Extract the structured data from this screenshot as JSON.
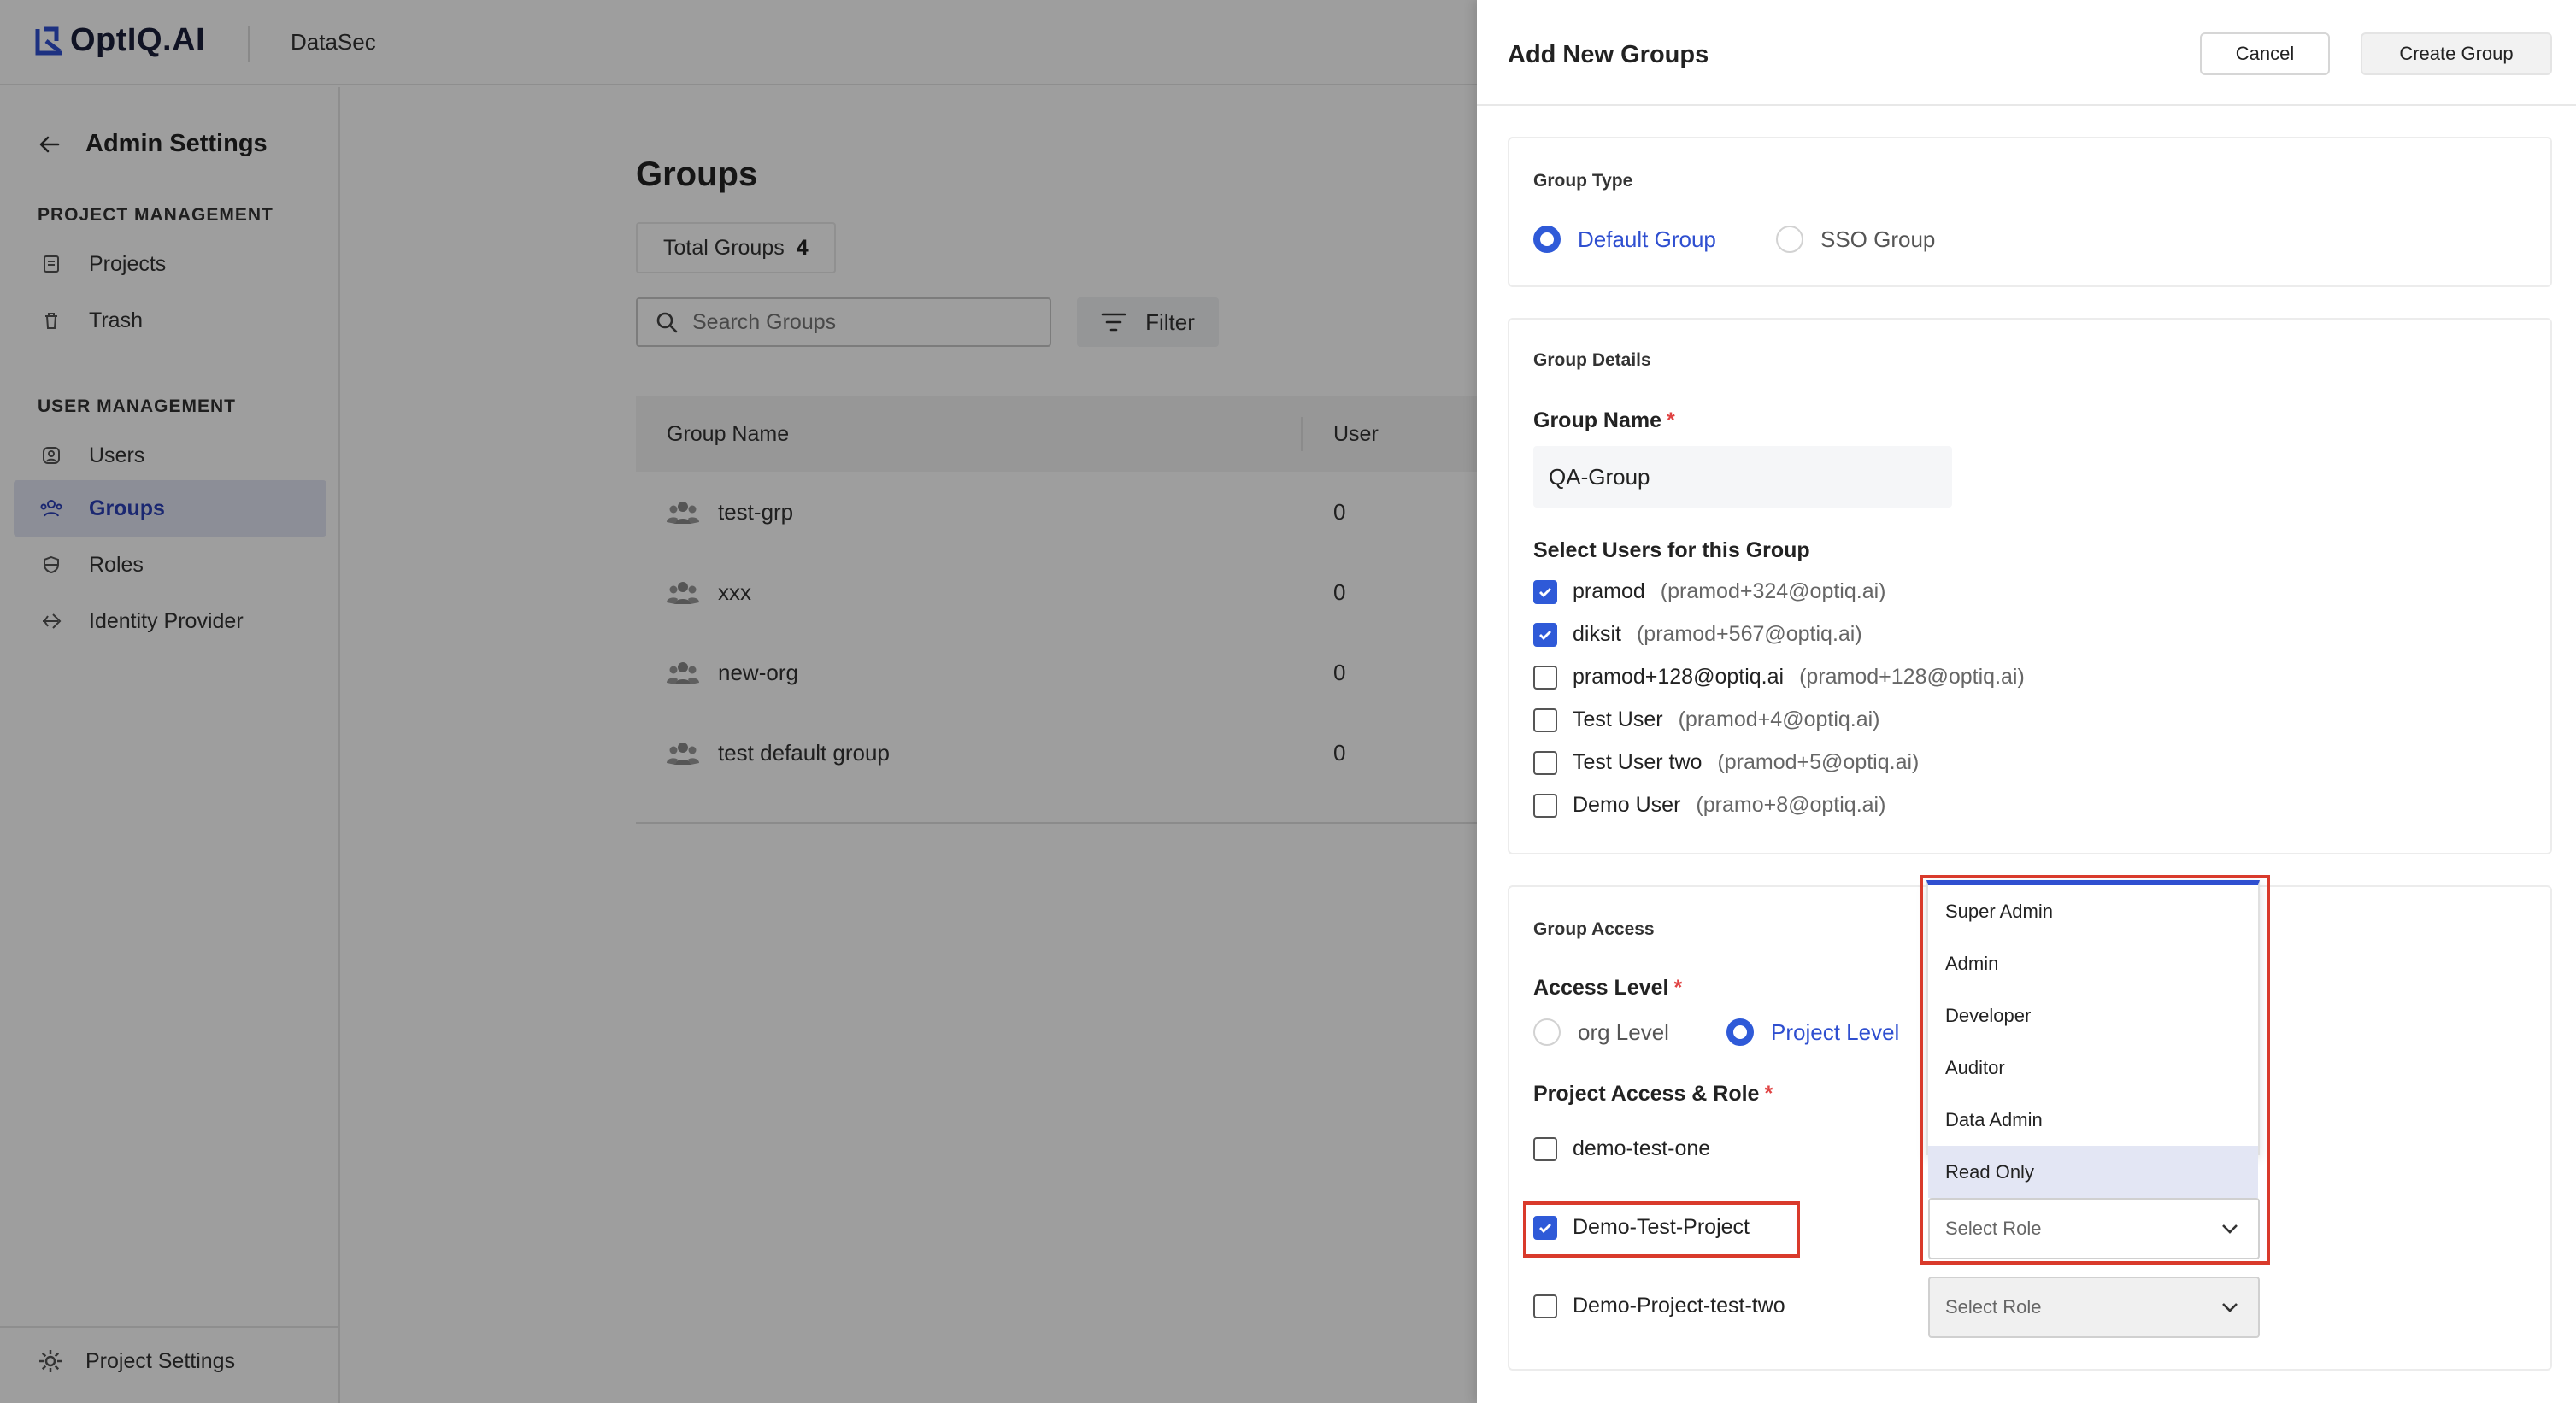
{
  "app": {
    "brand": "OptIQ.AI",
    "workspace": "DataSec"
  },
  "sidebar": {
    "back_title": "Admin Settings",
    "sections": [
      {
        "title": "PROJECT MANAGEMENT",
        "items": [
          {
            "label": "Projects",
            "icon": "document-icon"
          },
          {
            "label": "Trash",
            "icon": "trash-icon"
          }
        ]
      },
      {
        "title": "USER MANAGEMENT",
        "items": [
          {
            "label": "Users",
            "icon": "user-icon"
          },
          {
            "label": "Groups",
            "icon": "group-icon",
            "active": true
          },
          {
            "label": "Roles",
            "icon": "shield-icon"
          },
          {
            "label": "Identity Provider",
            "icon": "login-icon"
          }
        ]
      }
    ],
    "footer": {
      "label": "Project Settings",
      "icon": "gear-icon"
    }
  },
  "main": {
    "title": "Groups",
    "total_label": "Total Groups",
    "total_value": "4",
    "search_placeholder": "Search Groups",
    "filter_label": "Filter",
    "columns": [
      "Group Name",
      "User"
    ],
    "rows": [
      {
        "name": "test-grp",
        "users": "0"
      },
      {
        "name": "xxx",
        "users": "0"
      },
      {
        "name": "new-org",
        "users": "0"
      },
      {
        "name": "test default group",
        "users": "0"
      }
    ]
  },
  "drawer": {
    "title": "Add New Groups",
    "cancel_label": "Cancel",
    "create_label": "Create Group",
    "group_type": {
      "label": "Group Type",
      "options": [
        {
          "label": "Default Group",
          "selected": true
        },
        {
          "label": "SSO Group",
          "selected": false
        }
      ]
    },
    "group_details": {
      "label": "Group Details",
      "name_label": "Group Name",
      "name_value": "QA-Group",
      "users_label": "Select Users for this Group",
      "users": [
        {
          "name": "pramod",
          "email": "(pramod+324@optiq.ai)",
          "checked": true
        },
        {
          "name": "diksit",
          "email": "(pramod+567@optiq.ai)",
          "checked": true
        },
        {
          "name": "pramod+128@optiq.ai",
          "email": "(pramod+128@optiq.ai)",
          "checked": false
        },
        {
          "name": "Test User",
          "email": "(pramod+4@optiq.ai)",
          "checked": false
        },
        {
          "name": "Test User two",
          "email": "(pramod+5@optiq.ai)",
          "checked": false
        },
        {
          "name": "Demo User",
          "email": "(pramo+8@optiq.ai)",
          "checked": false
        }
      ]
    },
    "group_access": {
      "label": "Group Access",
      "access_level_label": "Access Level",
      "levels": [
        {
          "label": "org Level",
          "selected": false
        },
        {
          "label": "Project Level",
          "selected": true
        }
      ],
      "project_role_label": "Project Access & Role",
      "projects": [
        {
          "name": "demo-test-one",
          "checked": false
        },
        {
          "name": "Demo-Test-Project",
          "checked": true,
          "role_placeholder": "Select Role"
        },
        {
          "name": "Demo-Project-test-two",
          "checked": false,
          "role_placeholder": "Select Role"
        }
      ]
    },
    "role_options": [
      "Super Admin",
      "Admin",
      "Developer",
      "Auditor",
      "Data Admin",
      "Read Only"
    ],
    "highlighted_role": "Read Only"
  },
  "colors": {
    "accent": "#2f4fd0",
    "highlight": "#d93a2b",
    "active_bg": "#e3e6f4"
  }
}
